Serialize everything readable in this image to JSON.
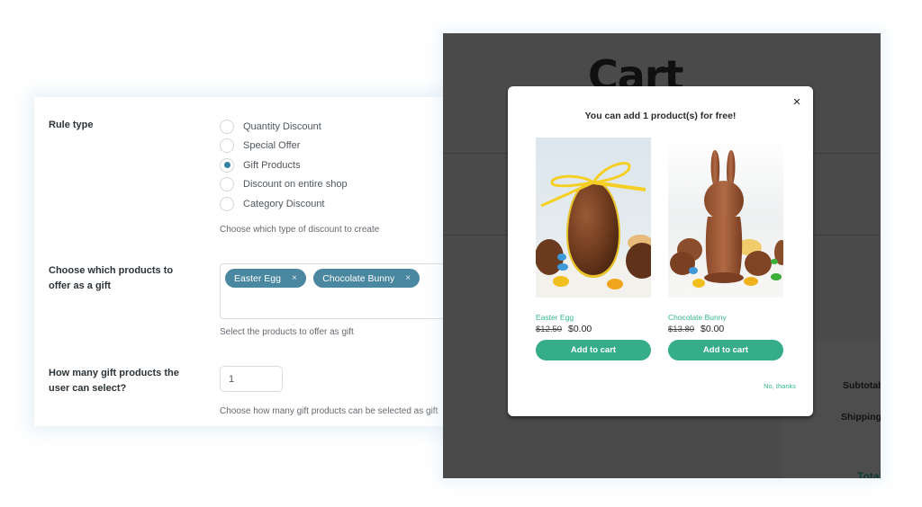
{
  "settings": {
    "rule_type": {
      "label": "Rule type",
      "options": [
        {
          "label": "Quantity Discount",
          "checked": false
        },
        {
          "label": "Special Offer",
          "checked": false
        },
        {
          "label": "Gift Products",
          "checked": true
        },
        {
          "label": "Discount on entire shop",
          "checked": false
        },
        {
          "label": "Category Discount",
          "checked": false
        }
      ],
      "help": "Choose which type of discount to create"
    },
    "gift_products": {
      "label_line1": "Choose which products to",
      "label_line2": "offer as a gift",
      "tags": [
        {
          "label": "Easter Egg",
          "remove": "×"
        },
        {
          "label": "Chocolate Bunny",
          "remove": "×"
        }
      ],
      "help": "Select the products to offer as gift"
    },
    "gift_count": {
      "label_line1": "How many gift products the",
      "label_line2": "user can select?",
      "value": "1",
      "help": "Choose how many gift products can be selected as gift"
    }
  },
  "cart": {
    "title": "Cart",
    "totals": {
      "subtotal": "Subtotal",
      "shipping": "Shipping",
      "total": "Total"
    }
  },
  "modal": {
    "title": "You can add 1 product(s) for free!",
    "close_icon": "×",
    "products": [
      {
        "name": "Easter Egg",
        "old_price": "$12.50",
        "new_price": "$0.00",
        "button": "Add to cart",
        "image": "easter-egg"
      },
      {
        "name": "Chocolate Bunny",
        "old_price": "$13.80",
        "new_price": "$0.00",
        "button": "Add to cart",
        "image": "chocolate-bunny"
      }
    ],
    "decline": "No, thanks"
  },
  "colors": {
    "accent_blue": "#3582a4",
    "tag_blue": "#4a87a0",
    "cta_green": "#35ad88",
    "overlay": "#4a4a4a"
  }
}
